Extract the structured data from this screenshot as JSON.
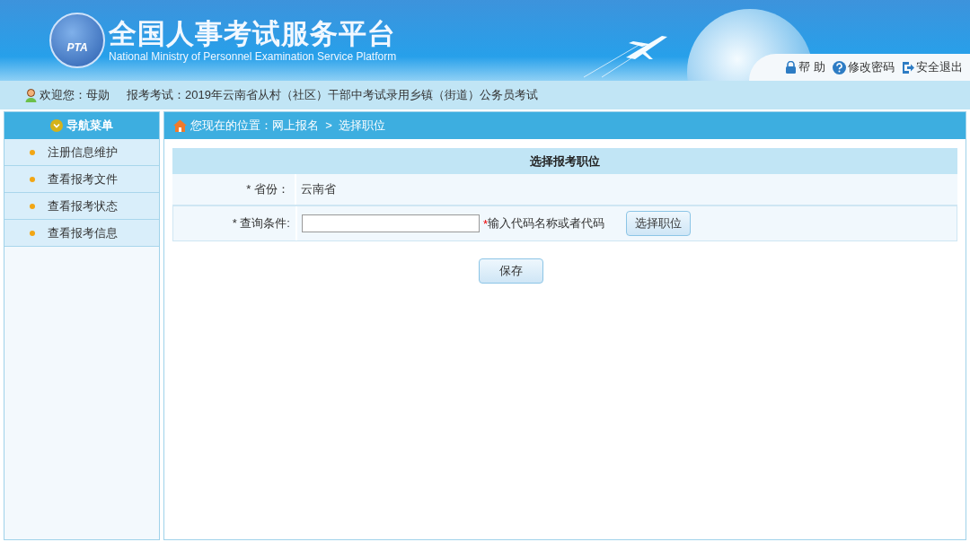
{
  "header": {
    "logo_text": "PTA",
    "title": "全国人事考试服务平台",
    "subtitle": "National Ministry of Personnel Examination Service Platform",
    "links": [
      {
        "kind": "help",
        "label": "帮 助"
      },
      {
        "kind": "password",
        "label": "修改密码"
      },
      {
        "kind": "logout",
        "label": "安全退出"
      }
    ]
  },
  "info_bar": {
    "welcome": "欢迎您：母勋",
    "exam": "报考考试：2019年云南省从村（社区）干部中考试录用乡镇（街道）公务员考试"
  },
  "sidebar": {
    "title": "导航菜单",
    "items": [
      {
        "label": "注册信息维护"
      },
      {
        "label": "查看报考文件"
      },
      {
        "label": "查看报考状态"
      },
      {
        "label": "查看报考信息"
      }
    ]
  },
  "breadcrumb": "您现在的位置：网上报名  >  选择职位",
  "form": {
    "title": "选择报考职位",
    "province_label": "* 省份：",
    "province_value": "云南省",
    "query_label": "* 查询条件:",
    "query_mark": "*",
    "query_hint": "输入代码名称或者代码",
    "select_button": "选择职位",
    "save_button": "保存"
  }
}
